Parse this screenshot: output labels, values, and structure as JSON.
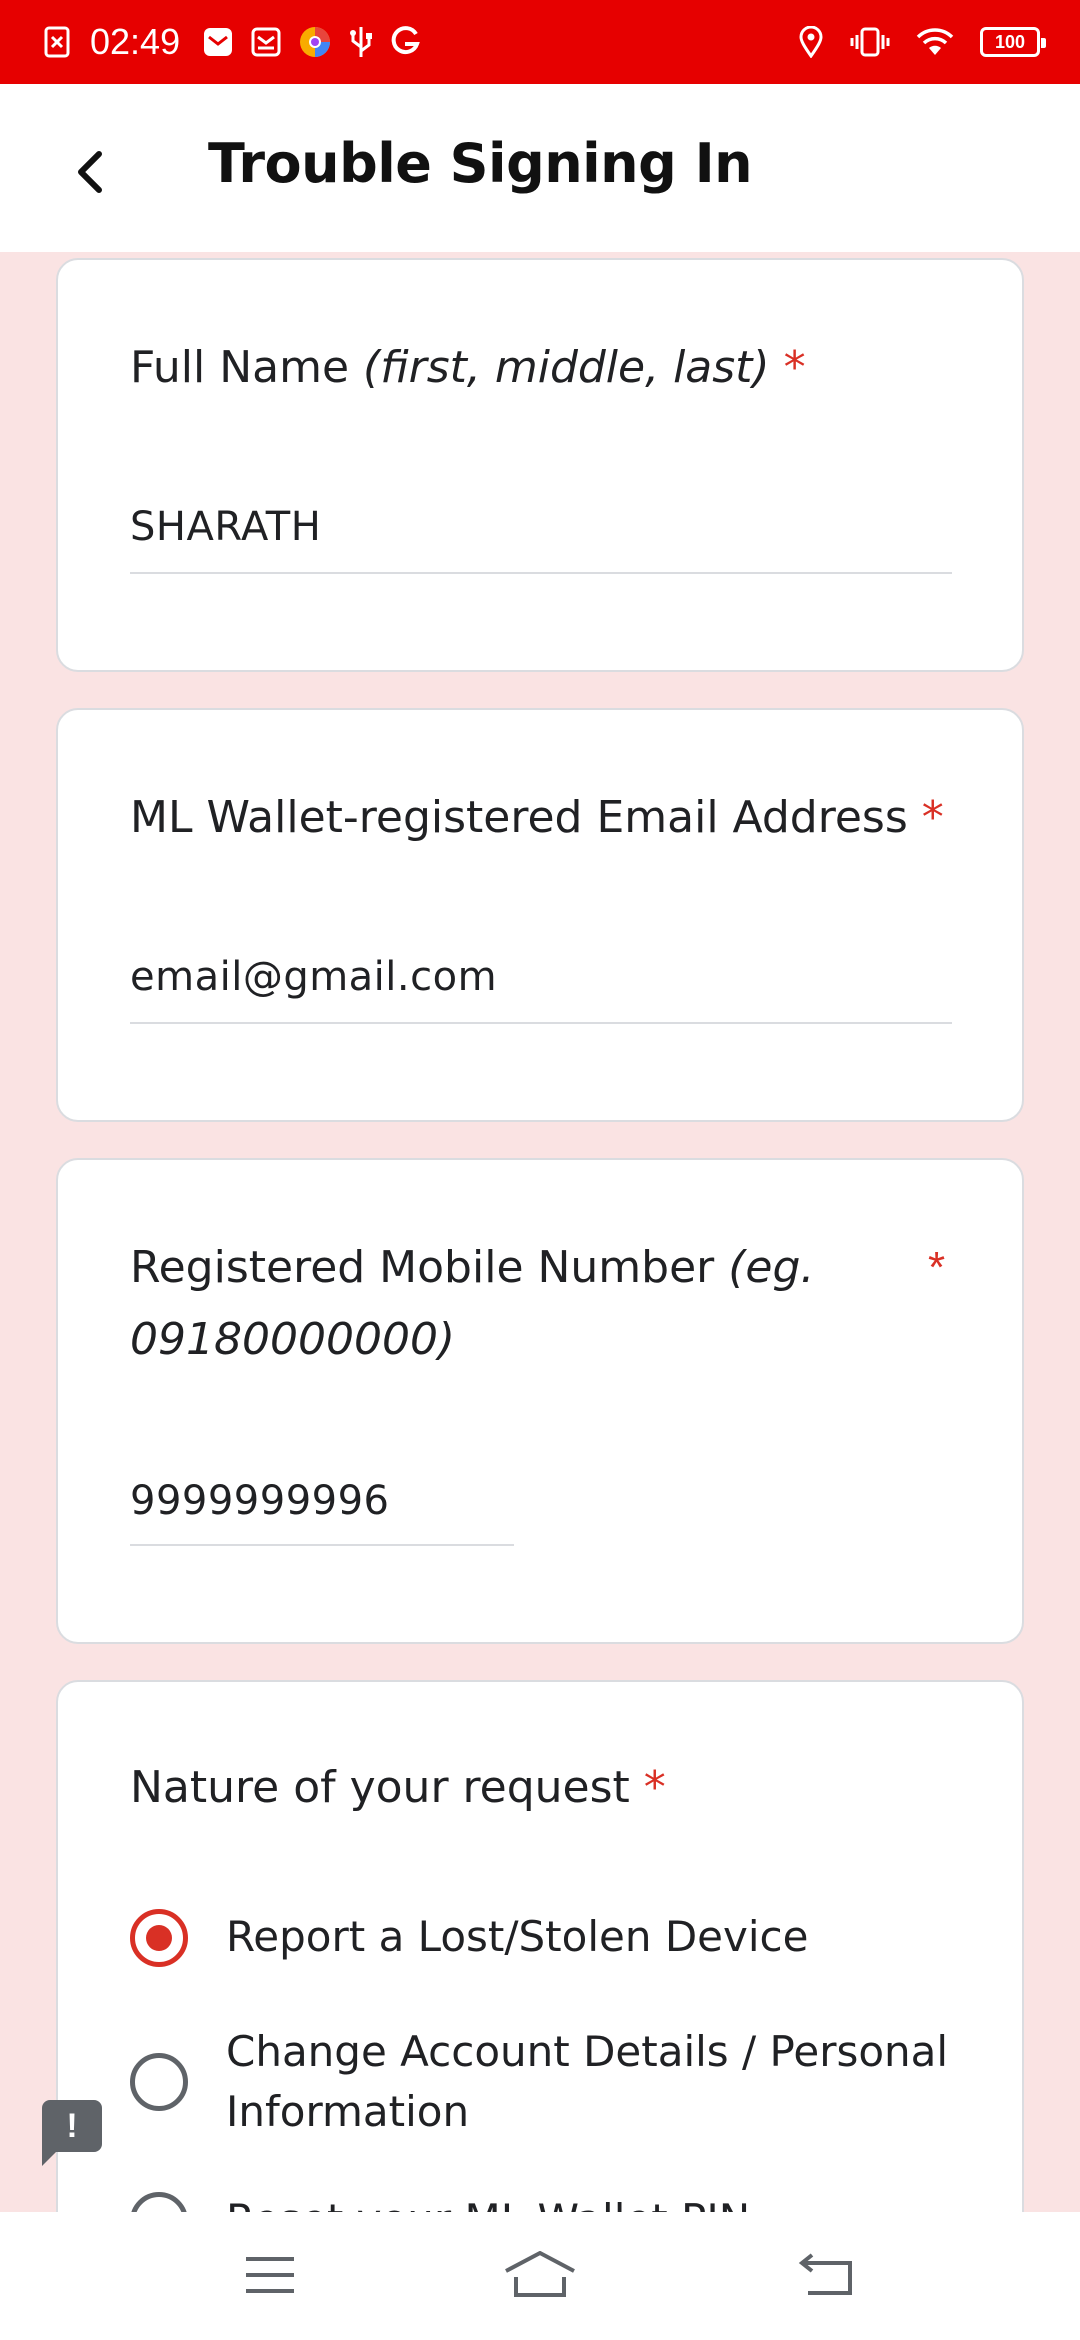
{
  "status_bar": {
    "time": "02:49",
    "battery": "100",
    "left_icons": [
      "close-box-icon",
      "mail-icon",
      "inbox-icon",
      "browser-icon",
      "usb-icon",
      "google-icon"
    ],
    "right_icons": [
      "location-icon",
      "vibrate-icon",
      "wifi-icon",
      "battery-icon"
    ],
    "color": "#e60000"
  },
  "app_bar": {
    "title": "Trouble Signing In",
    "back_icon": "back-chevron-icon"
  },
  "form": {
    "required_mark": "*",
    "full_name": {
      "label": "Full Name ",
      "hint": "(first, middle, last)",
      "value": "SHARATH"
    },
    "email": {
      "label": "ML Wallet-registered Email Address",
      "value": "email@gmail.com"
    },
    "mobile": {
      "label": "Registered Mobile Number ",
      "hint_line1": "(eg.",
      "hint_line2": "09180000000)",
      "value": "9999999996"
    },
    "request": {
      "label": "Nature of your request",
      "options": [
        {
          "label": "Report a Lost/Stolen Device",
          "checked": true
        },
        {
          "label_line1": "Change Account Details / Personal",
          "label_line2": "Information",
          "checked": false
        },
        {
          "label": "Reset your ML Wallet PIN",
          "checked": false
        }
      ]
    }
  },
  "feedback_icon": "!",
  "nav_bar": {
    "icons": [
      "menu-icon",
      "home-icon",
      "back-icon"
    ]
  },
  "colors": {
    "accent": "#d93025",
    "background": "#fae3e3"
  }
}
